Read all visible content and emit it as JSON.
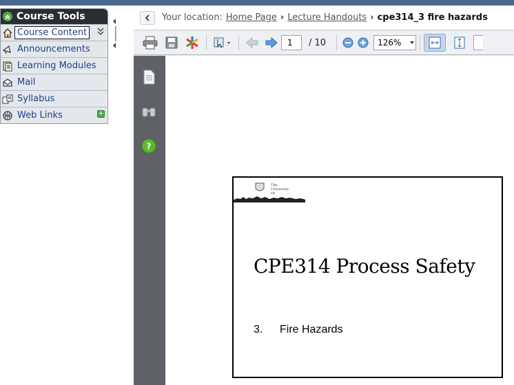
{
  "course_tools": {
    "title": "Course Tools",
    "items": [
      {
        "label": "Course Content",
        "icon": "home-icon",
        "active": true
      },
      {
        "label": "Announcements",
        "icon": "megaphone-icon"
      },
      {
        "label": "Learning Modules",
        "icon": "module-icon"
      },
      {
        "label": "Mail",
        "icon": "mail-icon"
      },
      {
        "label": "Syllabus",
        "icon": "syllabus-icon"
      },
      {
        "label": "Web Links",
        "icon": "globe-icon"
      }
    ]
  },
  "breadcrumb": {
    "prefix": "Your location:",
    "items": [
      "Home Page",
      "Lecture Handouts"
    ],
    "current": "cpe314_3 fire hazards"
  },
  "toolbar": {
    "page": "1",
    "total_pages": "/  10",
    "zoom": "126%"
  },
  "slide": {
    "logo_text": "The University Of",
    "title": "CPE314 Process Safety",
    "number": "3.",
    "item": "Fire Hazards"
  },
  "colors": {
    "header_dark": "#2a2d32",
    "link_blue": "#1f3f86",
    "viewer_sidebar": "#5e6165",
    "accent_green": "#53a63c"
  }
}
